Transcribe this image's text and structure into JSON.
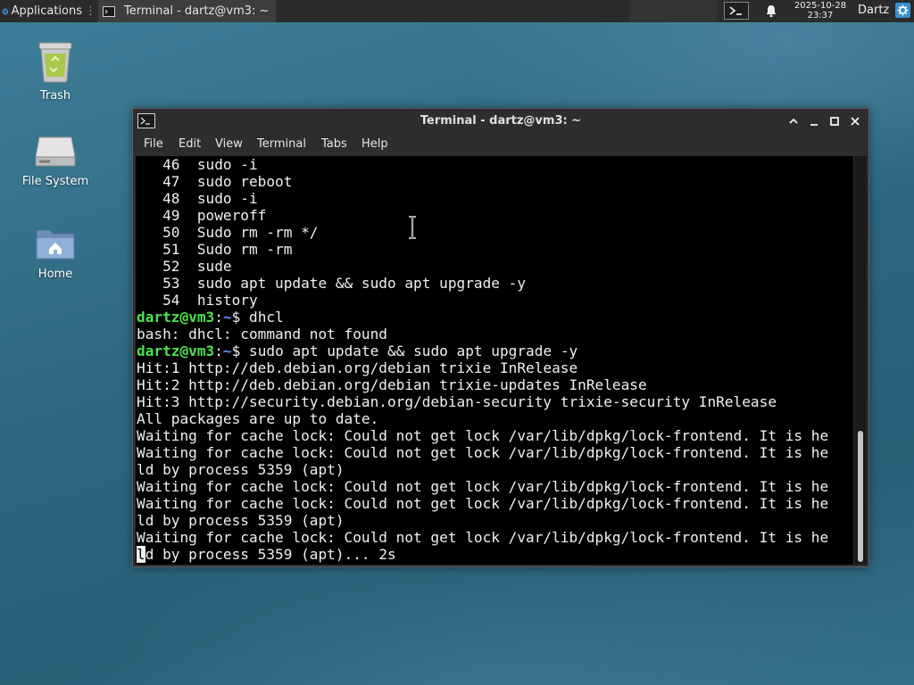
{
  "panel": {
    "applications_label": "Applications",
    "task_title": "Terminal - dartz@vm3: ~",
    "clock_date": "2025-10-28",
    "clock_time": "23:37",
    "user": "Dartz"
  },
  "desktop": {
    "icons": [
      {
        "label": "Trash",
        "icon": "trash-icon"
      },
      {
        "label": "File System",
        "icon": "drive-icon"
      },
      {
        "label": "Home",
        "icon": "home-folder-icon"
      }
    ]
  },
  "window": {
    "title": "Terminal - dartz@vm3: ~",
    "menu": [
      "File",
      "Edit",
      "View",
      "Terminal",
      "Tabs",
      "Help"
    ]
  },
  "terminal": {
    "lines": [
      {
        "text": "   46  sudo -i"
      },
      {
        "text": "   47  sudo reboot"
      },
      {
        "text": "   48  sudo -i"
      },
      {
        "text": "   49  poweroff"
      },
      {
        "text": "   50  Sudo rm -rm */"
      },
      {
        "text": "   51  Sudo rm -rm"
      },
      {
        "text": "   52  sude"
      },
      {
        "text": "   53  sudo apt update && sudo apt upgrade -y"
      },
      {
        "text": "   54  history"
      },
      {
        "user": "dartz@vm3",
        "path": "~",
        "cmd": "$ dhcl"
      },
      {
        "text": "bash: dhcl: command not found"
      },
      {
        "user": "dartz@vm3",
        "path": "~",
        "cmd": "$ sudo apt update && sudo apt upgrade -y"
      },
      {
        "text": "Hit:1 http://deb.debian.org/debian trixie InRelease"
      },
      {
        "text": "Hit:2 http://deb.debian.org/debian trixie-updates InRelease"
      },
      {
        "text": "Hit:3 http://security.debian.org/debian-security trixie-security InRelease"
      },
      {
        "text": "All packages are up to date."
      },
      {
        "text": "Waiting for cache lock: Could not get lock /var/lib/dpkg/lock-frontend. It is he"
      },
      {
        "text": "Waiting for cache lock: Could not get lock /var/lib/dpkg/lock-frontend. It is he"
      },
      {
        "text": "ld by process 5359 (apt)"
      },
      {
        "text": "Waiting for cache lock: Could not get lock /var/lib/dpkg/lock-frontend. It is he"
      },
      {
        "text": "Waiting for cache lock: Could not get lock /var/lib/dpkg/lock-frontend. It is he"
      },
      {
        "text": "ld by process 5359 (apt)"
      },
      {
        "text": "Waiting for cache lock: Could not get lock /var/lib/dpkg/lock-frontend. It is he"
      },
      {
        "cursor": "l",
        "text": "d by process 5359 (apt)... 2s"
      }
    ]
  },
  "colors": {
    "prompt_user": "#4ce34c",
    "prompt_path": "#5c8eff",
    "terminal_bg": "#000000"
  }
}
